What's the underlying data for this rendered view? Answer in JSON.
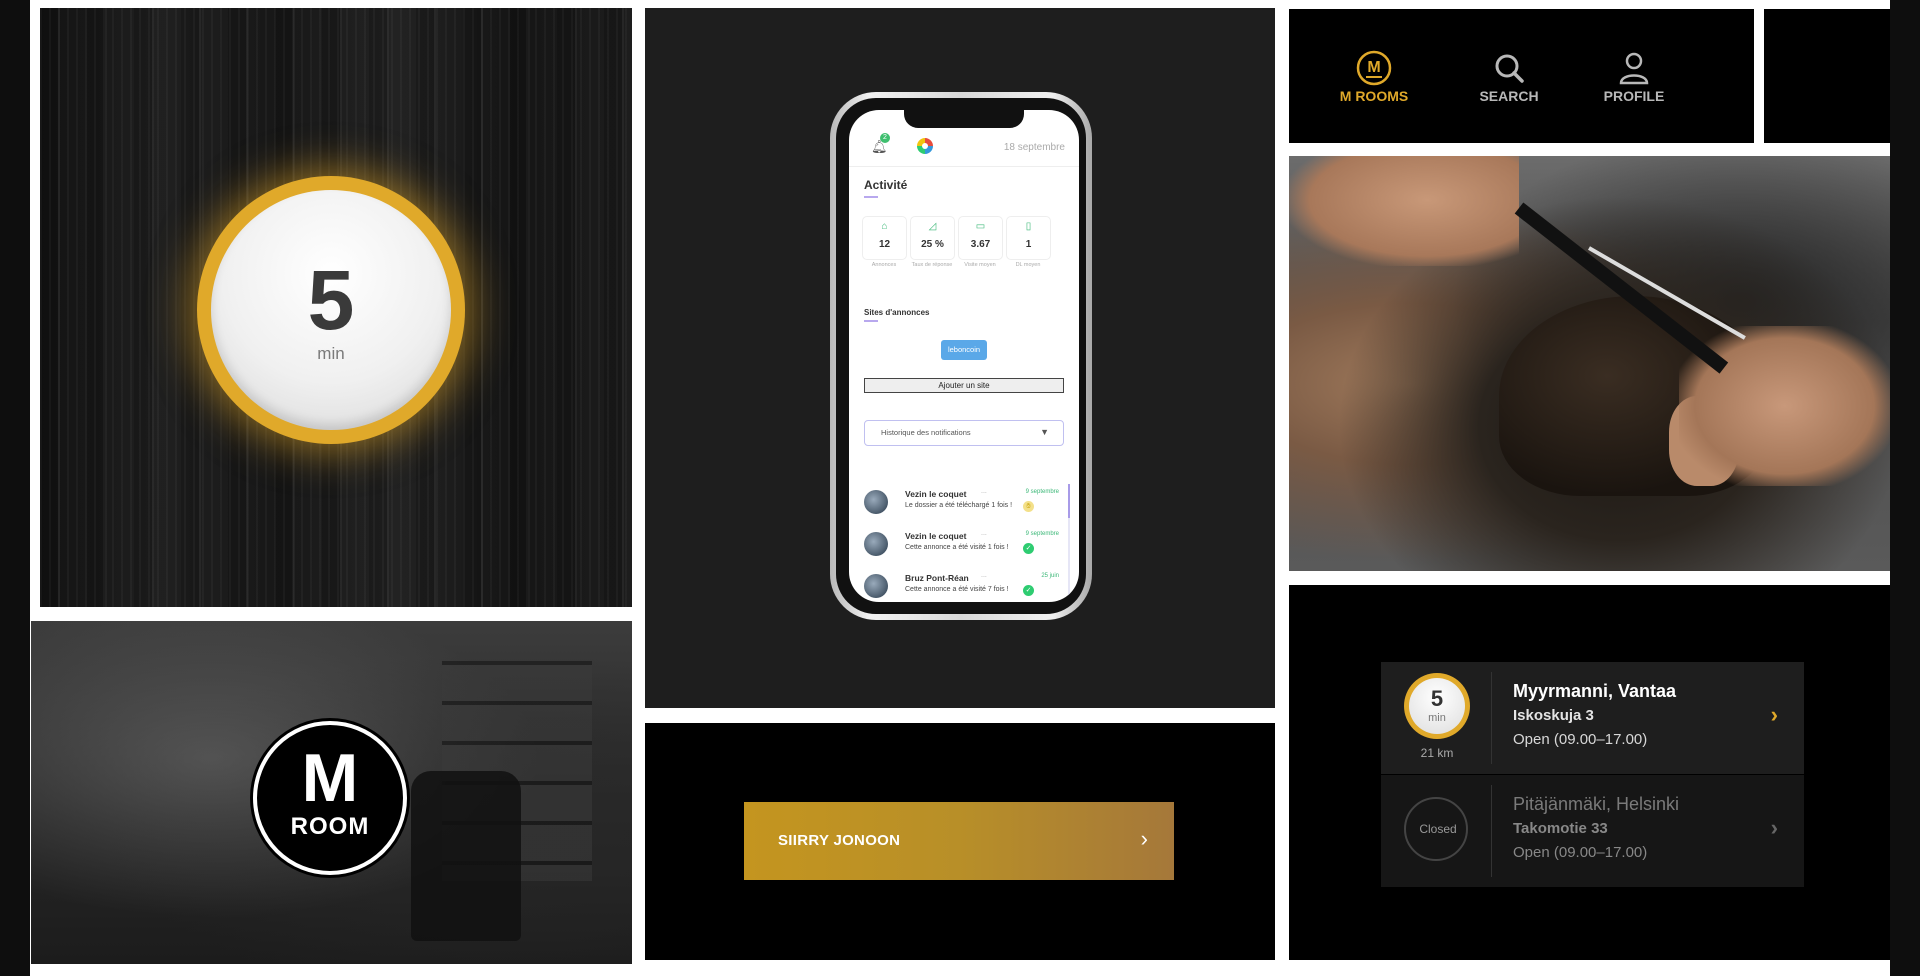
{
  "timer_tile": {
    "value": "5",
    "unit": "min"
  },
  "logo_tile": {
    "logo_top": "M",
    "logo_bottom": "ROOM"
  },
  "phone": {
    "date": "18 septembre",
    "notification_count": "2",
    "activity_title": "Activité",
    "stats": [
      {
        "icon": "house-icon",
        "glyph": "⌂",
        "value": "12",
        "label": "Annonces"
      },
      {
        "icon": "chart-icon",
        "glyph": "◿",
        "value": "25 %",
        "label": "Taux de réponse"
      },
      {
        "icon": "card-icon",
        "glyph": "▭",
        "value": "3.67",
        "label": "Visite moyen"
      },
      {
        "icon": "file-icon",
        "glyph": "▯",
        "value": "1",
        "label": "DL moyen"
      }
    ],
    "sites_title": "Sites d'annonces",
    "site_button": "leboncoin",
    "add_site": "Ajouter un site",
    "history_dropdown": "Historique des notifications",
    "notifications": [
      {
        "title": "Vezin le coquet",
        "date": "9 septembre",
        "body": "Le dossier a été téléchargé 1 fois !",
        "status": "pending"
      },
      {
        "title": "Vezin le coquet",
        "date": "9 septembre",
        "body": "Cette annonce a été visité 1 fois !",
        "status": "done"
      },
      {
        "title": "Bruz Pont-Réan",
        "date": "25 juin",
        "body": "Cette annonce a été visité 7 fois !",
        "status": "done"
      }
    ]
  },
  "cta": {
    "label": "SIIRRY JONOON"
  },
  "nav": {
    "items": [
      {
        "label": "M ROOMS",
        "active": true
      },
      {
        "label": "SEARCH",
        "active": false
      },
      {
        "label": "PROFILE",
        "active": false
      }
    ],
    "active_color": "#e0a92a",
    "inactive_color": "#b8b8b8"
  },
  "locations": [
    {
      "time_value": "5",
      "time_unit": "min",
      "distance": "21 km",
      "name": "Myyrmanni, Vantaa",
      "street": "Iskoskuja 3",
      "hours": "Open (09.00–17.00)",
      "closed": false
    },
    {
      "status": "Closed",
      "name": "Pitäjänmäki, Helsinki",
      "street": "Takomotie 33",
      "hours": "Open (09.00–17.00)",
      "closed": true
    }
  ]
}
